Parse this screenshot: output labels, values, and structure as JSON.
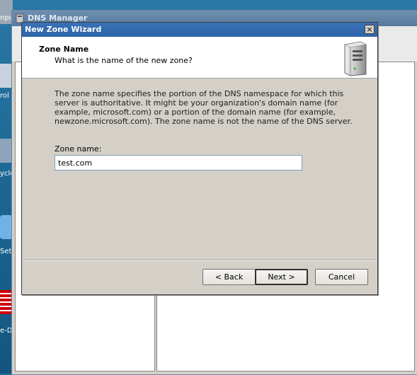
{
  "desktop": {
    "labels": [
      "npu",
      "rol I",
      "ycle",
      "Sett",
      "e-Di"
    ]
  },
  "dns_manager": {
    "title": "DNS Manager"
  },
  "wizard": {
    "title": "New Zone Wizard",
    "close_label": "×",
    "heading": "Zone Name",
    "subheading": "What is the name of the new zone?",
    "description": "The zone name specifies the portion of the DNS namespace for which this server is authoritative. It might be your organization's domain name (for example,  microsoft.com) or a portion of the domain name (for example, newzone.microsoft.com). The zone name is not the name of the DNS server.",
    "zone_name_label": "Zone name:",
    "zone_name_value": "test.com",
    "buttons": {
      "back": "< Back",
      "next": "Next >",
      "cancel": "Cancel"
    }
  },
  "colors": {
    "title_bar": "#2e64a8",
    "dialog_face": "#d4d0c8",
    "desktop": "#1f6f9a"
  },
  "icons": [
    "server-icon",
    "close-icon",
    "dns-app-icon"
  ]
}
